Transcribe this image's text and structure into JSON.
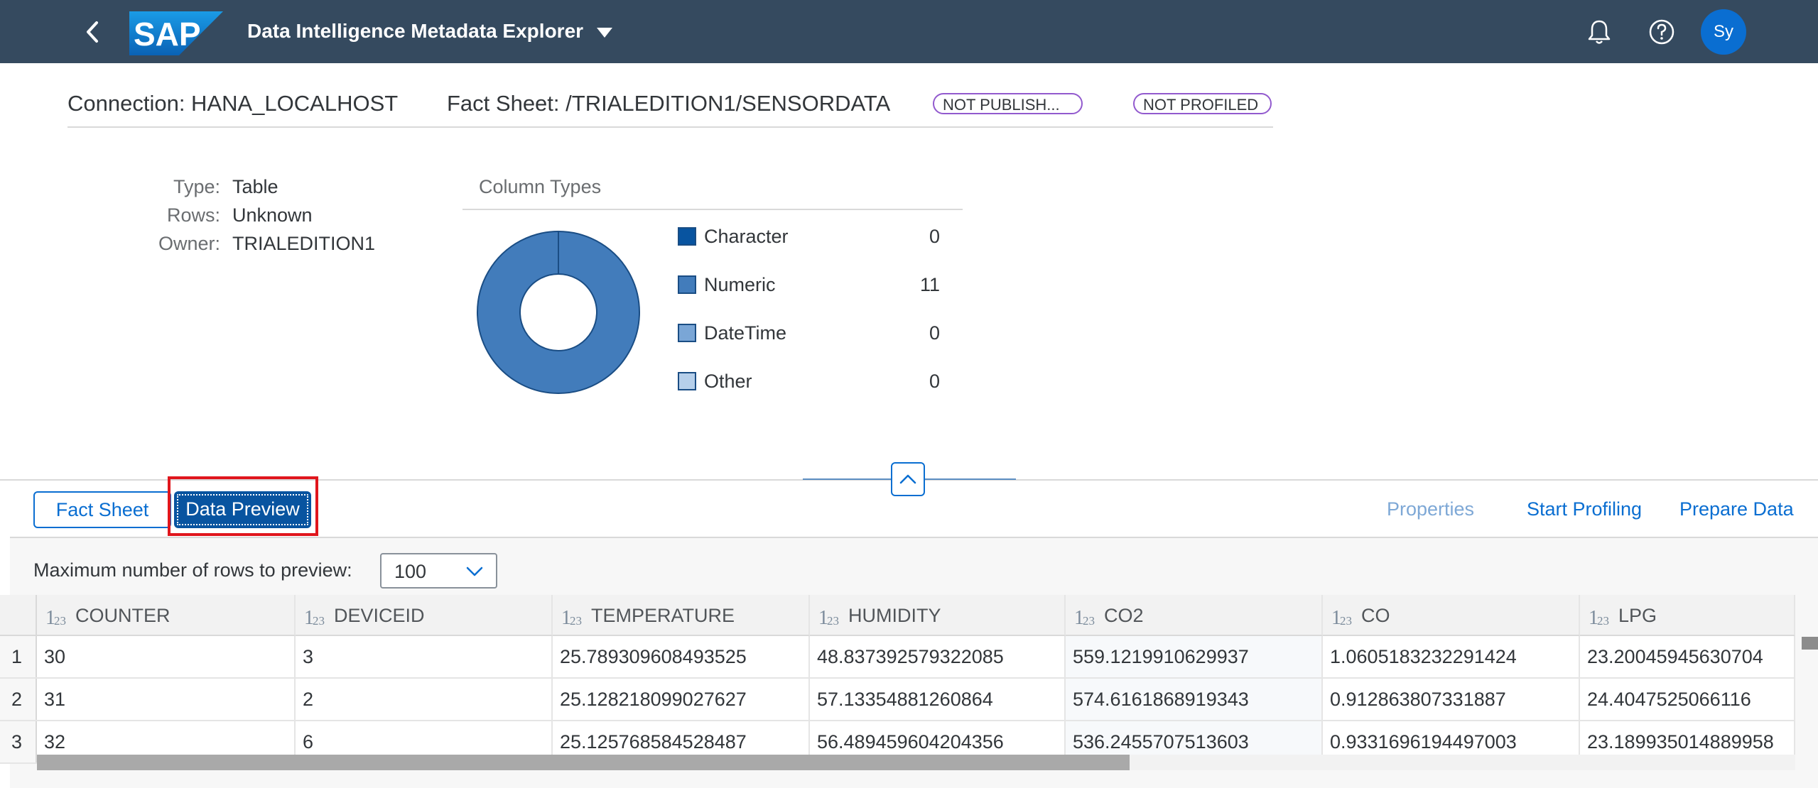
{
  "shell": {
    "title": "Data Intelligence Metadata Explorer",
    "logo_text": "SAP",
    "avatar_initials": "Sy",
    "colors": {
      "shell_bg": "#354a5f",
      "avatar_bg": "#0a6ed1",
      "logo_blue": "#0a7bd5"
    }
  },
  "header": {
    "connection": "Connection: HANA_LOCALHOST",
    "fact_sheet": "Fact Sheet: /TRIALEDITION1/SENSORDATA",
    "badges": [
      "NOT PUBLISH...",
      "NOT PROFILED"
    ],
    "badge_color": "#925ace"
  },
  "attributes": [
    {
      "label": "Type:",
      "value": "Table"
    },
    {
      "label": "Rows:",
      "value": "Unknown"
    },
    {
      "label": "Owner:",
      "value": "TRIALEDITION1"
    }
  ],
  "column_types": {
    "title": "Column Types",
    "legend": [
      {
        "label": "Character",
        "count": "0",
        "color": "#0854a0"
      },
      {
        "label": "Numeric",
        "count": "11",
        "color": "#427cbb"
      },
      {
        "label": "DateTime",
        "count": "0",
        "color": "#7aa6d6"
      },
      {
        "label": "Other",
        "count": "0",
        "color": "#b6cfea"
      }
    ]
  },
  "chart_data": {
    "type": "pie",
    "categories": [
      "Character",
      "Numeric",
      "DateTime",
      "Other"
    ],
    "values": [
      0,
      11,
      0,
      0
    ],
    "title": "Column Types"
  },
  "toolbar": {
    "tab_fact_sheet": "Fact Sheet",
    "tab_data_preview": "Data Preview",
    "properties": "Properties",
    "start_profiling": "Start Profiling",
    "prepare_data": "Prepare Data"
  },
  "preview": {
    "max_rows_label": "Maximum number of rows to preview:",
    "max_rows_value": "100",
    "type_icon": "numeric-type-icon",
    "type_glyph_main": "1",
    "type_glyph_sub": "23",
    "columns": [
      "COUNTER",
      "DEVICEID",
      "TEMPERATURE",
      "HUMIDITY",
      "CO2",
      "CO",
      "LPG"
    ],
    "rows": [
      {
        "num": "1",
        "cells": [
          "30",
          "3",
          "25.789309608493525",
          "48.837392579322085",
          "559.1219910629937",
          "1.0605183232291424",
          "23.20045945630704"
        ]
      },
      {
        "num": "2",
        "cells": [
          "31",
          "2",
          "25.128218099027627",
          "57.13354881260864",
          "574.6161868919343",
          "0.912863807331887",
          "24.4047525066116"
        ]
      },
      {
        "num": "3",
        "cells": [
          "32",
          "6",
          "25.125768584528487",
          "56.489459604204356",
          "536.2455707513603",
          "0.9331696194497003",
          "23.189935014889958"
        ]
      }
    ]
  }
}
